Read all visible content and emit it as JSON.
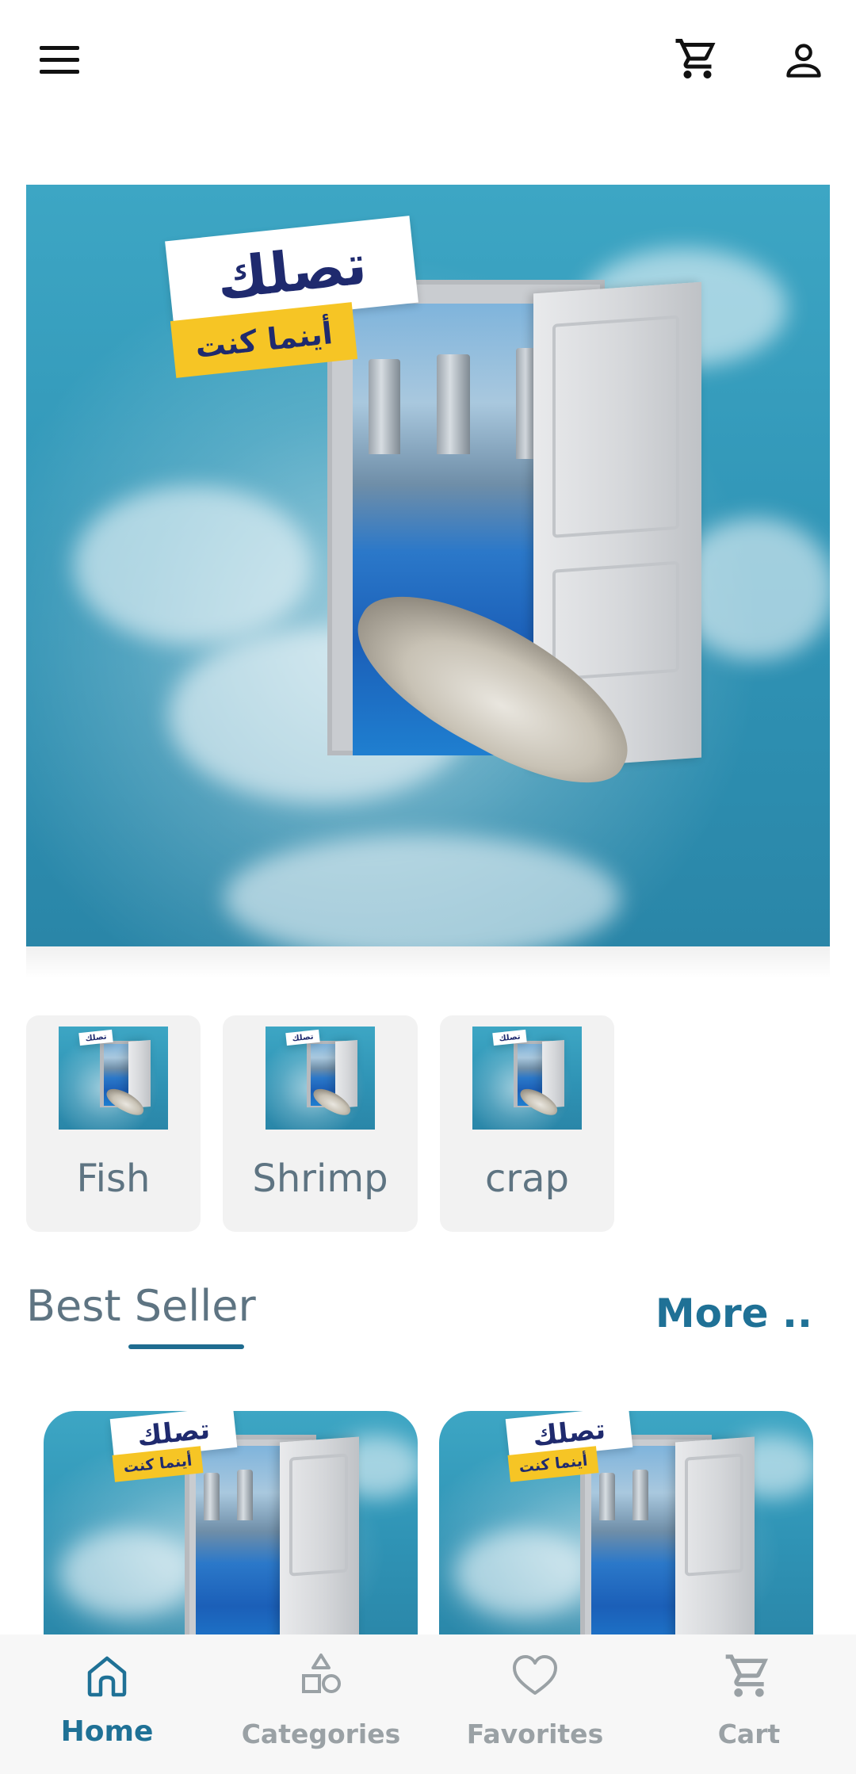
{
  "header": {
    "menu_icon": "hamburger-menu-icon",
    "cart_icon": "shopping-cart-icon",
    "profile_icon": "user-profile-icon"
  },
  "banner": {
    "headline": "تصلك",
    "tagline": "أينما كنت"
  },
  "categories": [
    {
      "label": "Fish"
    },
    {
      "label": "Shrimp"
    },
    {
      "label": "crap"
    }
  ],
  "best_seller": {
    "title": "Best Seller",
    "more_label": "More .."
  },
  "products": [
    {
      "headline": "تصلك",
      "tagline": "أينما كنت"
    },
    {
      "headline": "تصلك",
      "tagline": "أينما كنت"
    }
  ],
  "bottom_nav": {
    "items": [
      {
        "label": "Home",
        "icon": "home-icon",
        "active": true
      },
      {
        "label": "Categories",
        "icon": "shapes-icon",
        "active": false
      },
      {
        "label": "Favorites",
        "icon": "heart-icon",
        "active": false
      },
      {
        "label": "Cart",
        "icon": "shopping-cart-icon",
        "active": false
      }
    ]
  },
  "colors": {
    "accent": "#1f7196",
    "muted_text": "#5e7482",
    "inactive_nav": "#9aa1a5",
    "banner_blue": "#2f93b5"
  }
}
